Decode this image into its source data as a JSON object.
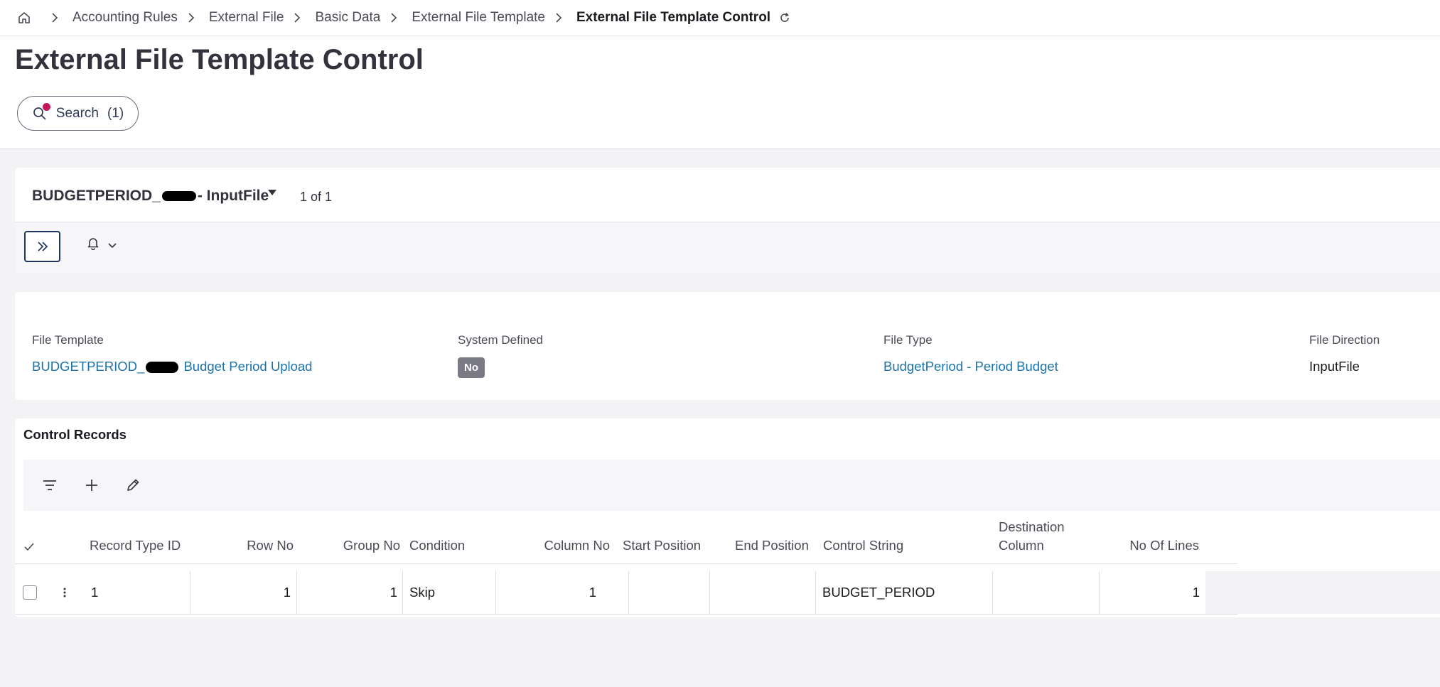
{
  "breadcrumb": {
    "items": [
      "Accounting Rules",
      "External File",
      "Basic Data",
      "External File Template"
    ],
    "current": "External File Template Control"
  },
  "page": {
    "title": "External File Template Control"
  },
  "search": {
    "label": "Search",
    "count": "(1)"
  },
  "record": {
    "title_prefix": "BUDGETPERIOD_",
    "title_suffix": "- InputFile",
    "position": "1 of 1"
  },
  "details": {
    "file_template": {
      "label": "File Template",
      "value_prefix": "BUDGETPERIOD_",
      "value_suffix": " Budget Period Upload"
    },
    "system_defined": {
      "label": "System Defined",
      "value": "No"
    },
    "file_type": {
      "label": "File Type",
      "value": "BudgetPeriod - Period Budget"
    },
    "file_direction": {
      "label": "File Direction",
      "value": "InputFile"
    }
  },
  "control_records": {
    "title": "Control Records",
    "columns": {
      "record_type_id": "Record Type ID",
      "row_no": "Row No",
      "group_no": "Group No",
      "condition": "Condition",
      "column_no": "Column No",
      "start_position": "Start Position",
      "end_position": "End Position",
      "control_string": "Control String",
      "destination_column_1": "Destination",
      "destination_column_2": "Column",
      "no_of_lines": "No Of Lines"
    },
    "rows": [
      {
        "record_type_id": "1",
        "row_no": "1",
        "group_no": "1",
        "condition": "Skip",
        "column_no": "1",
        "start_position": "",
        "end_position": "",
        "control_string": "BUDGET_PERIOD",
        "destination_column": "",
        "no_of_lines": "1"
      }
    ]
  },
  "colors": {
    "link": "#1a73a8",
    "badge_no": "#7a7a84",
    "search_dot": "#c2185b",
    "expand_border": "#1f3561"
  }
}
